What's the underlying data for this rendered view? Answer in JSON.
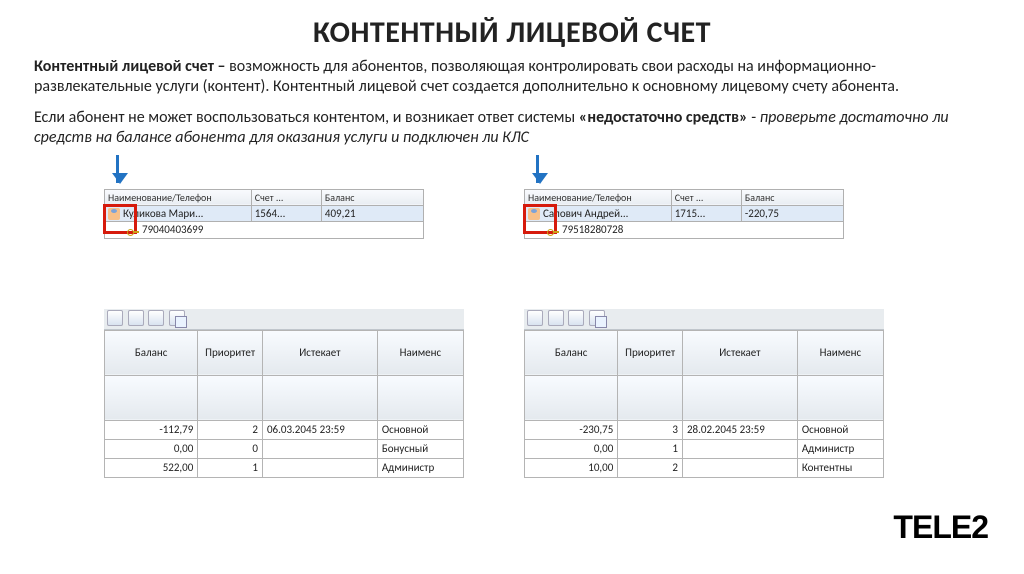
{
  "title": "КОНТЕНТНЫЙ ЛИЦЕВОЙ СЧЕТ",
  "para1_bold": "Контентный лицевой счет – ",
  "para1_rest": "возможность для абонентов, позволяющая контролировать свои расходы на информационно-развлекательные услуги (контент). Контентный лицевой счет создается дополнительно к основному лицевому счету абонента.",
  "para2_a": "Если абонент не может воспользоваться контентом, и возникает ответ системы ",
  "para2_bold": "«недостаточно средств»",
  "para2_b": " - ",
  "para2_italic": "проверьте достаточно ли средств на балансе абонента для оказания услуги и подключен ли КЛС",
  "top": {
    "headers": {
      "name": "Наименование/Телефон",
      "acct": "Счет ...",
      "bal": "Баланс"
    },
    "left": {
      "row1": {
        "name": "Куликова Мари...",
        "acct": "1564...",
        "bal": "409,21"
      },
      "row2": {
        "phone": "79040403699"
      }
    },
    "right": {
      "row1": {
        "name": "Сапович Андрей...",
        "acct": "1715...",
        "bal": "-220,75"
      },
      "row2": {
        "phone": "79518280728"
      }
    }
  },
  "bottom": {
    "headers": {
      "bal": "Баланс",
      "prio": "Приоритет",
      "exp": "Истекает",
      "name": "Наименс"
    },
    "left": {
      "r1": {
        "bal": "-112,79",
        "prio": "2",
        "exp": "06.03.2045 23:59",
        "name": "Основной"
      },
      "r2": {
        "bal": "0,00",
        "prio": "0",
        "exp": "",
        "name": "Бонусный"
      },
      "r3": {
        "bal": "522,00",
        "prio": "1",
        "exp": "",
        "name": "Администр"
      }
    },
    "right": {
      "r1": {
        "bal": "-230,75",
        "prio": "3",
        "exp": "28.02.2045 23:59",
        "name": "Основной"
      },
      "r2": {
        "bal": "0,00",
        "prio": "1",
        "exp": "",
        "name": "Администр"
      },
      "r3": {
        "bal": "10,00",
        "prio": "2",
        "exp": "",
        "name": "Контентны"
      }
    }
  },
  "logo": "TELE2"
}
